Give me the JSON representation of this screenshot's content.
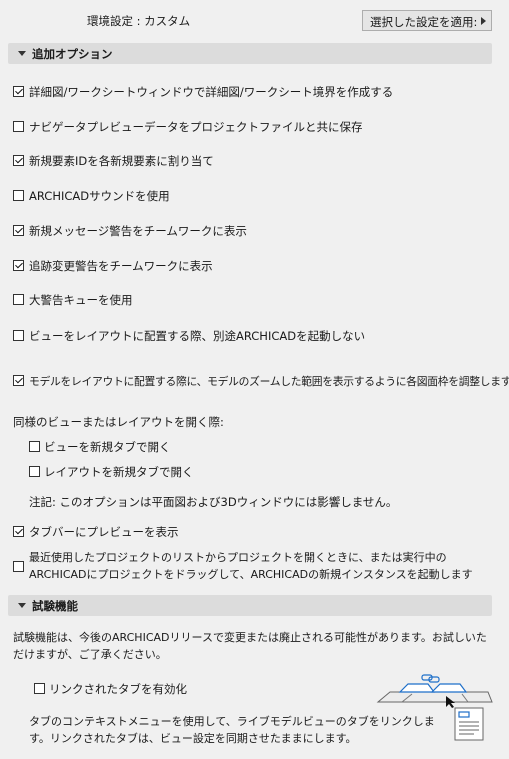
{
  "header": {
    "env_label": "環境設定 : カスタム",
    "apply_button": "選択した設定を適用:"
  },
  "section_options": {
    "title": "追加オプション",
    "items": [
      {
        "label": "詳細図/ワークシートウィンドウで詳細図/ワークシート境界を作成する",
        "checked": true
      },
      {
        "label": "ナビゲータプレビューデータをプロジェクトファイルと共に保存",
        "checked": false
      },
      {
        "label": "新規要素IDを各新規要素に割り当て",
        "checked": true
      },
      {
        "label": "ARCHICADサウンドを使用",
        "checked": false
      },
      {
        "label": "新規メッセージ警告をチームワークに表示",
        "checked": true
      },
      {
        "label": "追跡変更警告をチームワークに表示",
        "checked": true
      },
      {
        "label": "大警告キューを使用",
        "checked": false
      },
      {
        "label": "ビューをレイアウトに配置する際、別途ARCHICADを起動しない",
        "checked": false
      },
      {
        "label": "モデルをレイアウトに配置する際に、モデルのズームした範囲を表示するように各図面枠を調整します",
        "checked": true
      }
    ],
    "open_group_label": "同様のビューまたはレイアウトを開く際:",
    "open_items": [
      {
        "label": "ビューを新規タブで開く",
        "checked": false
      },
      {
        "label": "レイアウトを新規タブで開く",
        "checked": false
      }
    ],
    "note": "注記: このオプションは平面図および3Dウィンドウには影響しません。",
    "tabbar_preview": {
      "label": "タブバーにプレビューを表示",
      "checked": true
    },
    "new_instance": {
      "label": "最近使用したプロジェクトのリストからプロジェクトを開くときに、または実行中のARCHICADにプロジェクトをドラッグして、ARCHICADの新規インスタンスを起動します",
      "checked": false
    }
  },
  "section_experimental": {
    "title": "試験機能",
    "description": "試験機能は、今後のARCHICADリリースで変更または廃止される可能性があります。お試しいただけますが、ご了承ください。",
    "linked_tabs": {
      "label": "リンクされたタブを有効化",
      "checked": false
    },
    "linked_tabs_description": "タブのコンテキストメニューを使用して、ライブモデルビューのタブをリンクします。リンクされたタブは、ビュー設定を同期させたままにします。",
    "icons": [
      "linked-tabs-illustration-icon",
      "view-settings-document-icon"
    ]
  }
}
